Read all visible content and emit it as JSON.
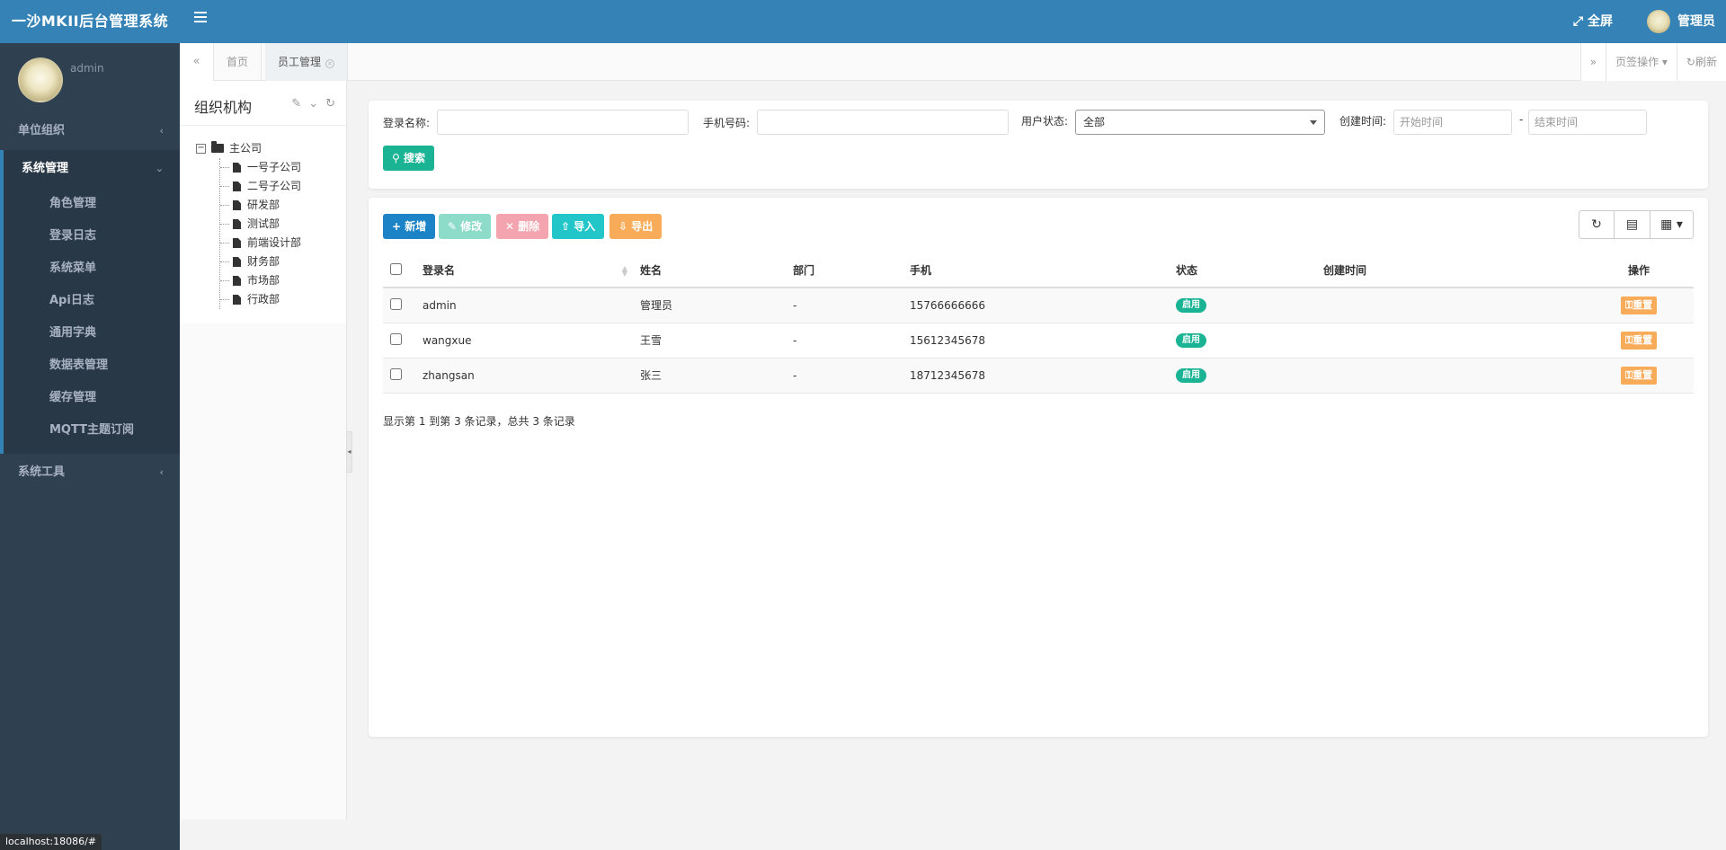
{
  "app": {
    "brand": "一沙MKII后台管理系统",
    "fullscreen_label": "全屏",
    "user_label": "管理员"
  },
  "sidebar": {
    "username": "admin",
    "items": [
      {
        "label": "单位组织"
      },
      {
        "label": "系统管理"
      },
      {
        "label": "系统工具"
      }
    ],
    "submenu": [
      {
        "label": "角色管理"
      },
      {
        "label": "登录日志"
      },
      {
        "label": "系统菜单"
      },
      {
        "label": "Api日志"
      },
      {
        "label": "通用字典"
      },
      {
        "label": "数据表管理"
      },
      {
        "label": "缓存管理"
      },
      {
        "label": "MQTT主题订阅"
      }
    ]
  },
  "tabs": {
    "home": "首页",
    "active": "员工管理",
    "page_ops": "页签操作",
    "refresh": "刷新"
  },
  "org": {
    "title": "组织机构",
    "root": "主公司",
    "children": [
      "一号子公司",
      "二号子公司",
      "研发部",
      "测试部",
      "前端设计部",
      "财务部",
      "市场部",
      "行政部"
    ]
  },
  "search": {
    "login_name_label": "登录名称:",
    "login_name_value": "",
    "phone_label": "手机号码:",
    "phone_value": "",
    "status_label": "用户状态:",
    "status_selected": "全部",
    "created_label": "创建时间:",
    "start_placeholder": "开始时间",
    "dash": "-",
    "end_placeholder": "结束时间",
    "search_button": "搜索"
  },
  "toolbar": {
    "add": "新增",
    "edit": "修改",
    "delete": "删除",
    "import": "导入",
    "export": "导出"
  },
  "table": {
    "columns": [
      "登录名",
      "姓名",
      "部门",
      "手机",
      "状态",
      "创建时间",
      "操作"
    ],
    "rows": [
      {
        "login": "admin",
        "name": "管理员",
        "dept": "-",
        "phone": "15766666666",
        "status": "启用",
        "created": "",
        "action": "重置"
      },
      {
        "login": "wangxue",
        "name": "王雪",
        "dept": "-",
        "phone": "15612345678",
        "status": "启用",
        "created": "",
        "action": "重置"
      },
      {
        "login": "zhangsan",
        "name": "张三",
        "dept": "-",
        "phone": "18712345678",
        "status": "启用",
        "created": "",
        "action": "重置"
      }
    ],
    "page_info": "显示第 1 到第 3 条记录，总共 3 条记录"
  },
  "statusbar": {
    "url": "localhost:18086/#"
  },
  "colors": {
    "topbar": "#3583b6",
    "sidebar": "#2f4050",
    "primary": "#1c84c6",
    "success": "#1ab394",
    "info": "#23c6c8",
    "warning": "#f8ac59",
    "danger": "#ed5565"
  }
}
